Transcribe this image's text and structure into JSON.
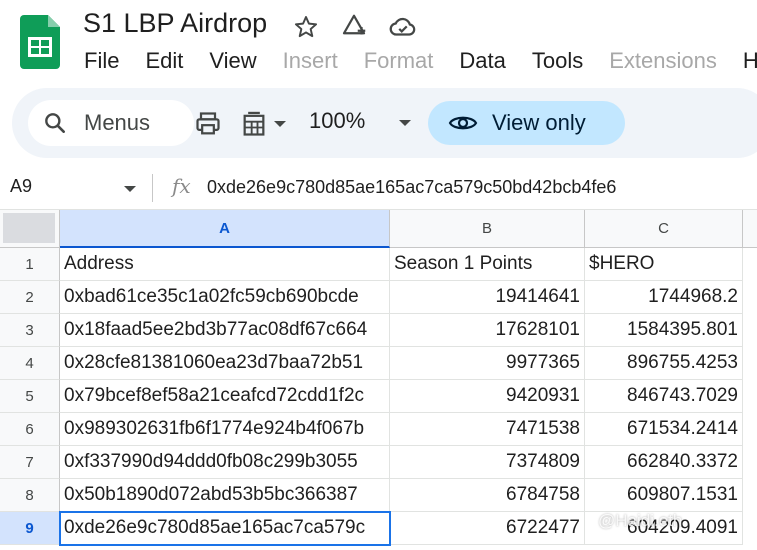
{
  "doc": {
    "title": "S1 LBP Airdrop"
  },
  "menu": [
    {
      "label": "File",
      "disabled": false
    },
    {
      "label": "Edit",
      "disabled": false
    },
    {
      "label": "View",
      "disabled": false
    },
    {
      "label": "Insert",
      "disabled": true
    },
    {
      "label": "Format",
      "disabled": true
    },
    {
      "label": "Data",
      "disabled": false
    },
    {
      "label": "Tools",
      "disabled": false
    },
    {
      "label": "Extensions",
      "disabled": true
    },
    {
      "label": "He",
      "disabled": false
    }
  ],
  "toolbar": {
    "search_label": "Menus",
    "zoom": "100%",
    "view_only_label": "View only"
  },
  "formula_bar": {
    "cell_ref": "A9",
    "fx_label": "fx",
    "content": "0xde26e9c780d85ae165ac7ca579c50bd42bcb4fe6"
  },
  "columns": [
    "A",
    "B",
    "C"
  ],
  "rows": [
    {
      "num": "1",
      "a": "Address",
      "b": "Season 1 Points",
      "c": "$HERO"
    },
    {
      "num": "2",
      "a": "0xbad61ce35c1a02fc59cb690bcde",
      "b": "19414641",
      "c": "1744968.2"
    },
    {
      "num": "3",
      "a": "0x18faad5ee2bd3b77ac08df67c664",
      "b": "17628101",
      "c": "1584395.801"
    },
    {
      "num": "4",
      "a": "0x28cfe81381060ea23d7baa72b51",
      "b": "9977365",
      "c": "896755.4253"
    },
    {
      "num": "5",
      "a": "0x79bcef8ef58a21ceafcd72cdd1f2c",
      "b": "9420931",
      "c": "846743.7029"
    },
    {
      "num": "6",
      "a": "0x989302631fb6f1774e924b4f067b",
      "b": "7471538",
      "c": "671534.2414"
    },
    {
      "num": "7",
      "a": "0xf337990d94ddd0fb08c299b3055",
      "b": "7374809",
      "c": "662840.3372"
    },
    {
      "num": "8",
      "a": "0x50b1890d072abd53b5bc366387",
      "b": "6784758",
      "c": "609807.1531"
    },
    {
      "num": "9",
      "a": "0xde26e9c780d85ae165ac7ca579c",
      "b": "6722477",
      "c": "604209.4091"
    }
  ],
  "selected_cell": "A9",
  "watermark": "@Haidi.eth",
  "colors": {
    "sheets_green": "#0f9d58",
    "view_only_bg": "#c2e7ff",
    "selection": "#1a73e8",
    "toolbar_bg": "#f0f4f9"
  }
}
